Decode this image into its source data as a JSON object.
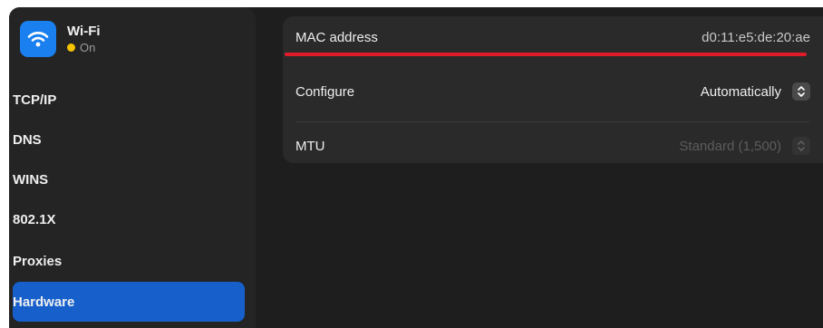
{
  "sidebar": {
    "header": {
      "title": "Wi-Fi",
      "status": "On",
      "status_color": "#f5c400",
      "icon": "wifi-icon"
    },
    "items": [
      {
        "label": "TCP/IP",
        "active": false
      },
      {
        "label": "DNS",
        "active": false
      },
      {
        "label": "WINS",
        "active": false
      },
      {
        "label": "802.1X",
        "active": false
      },
      {
        "label": "Proxies",
        "active": false
      },
      {
        "label": "Hardware",
        "active": true
      }
    ]
  },
  "hardware": {
    "mac": {
      "label": "MAC address",
      "value": "d0:11:e5:de:20:ae"
    },
    "configure": {
      "label": "Configure",
      "value": "Automatically"
    },
    "mtu": {
      "label": "MTU",
      "value": "Standard (1,500)",
      "disabled": true
    }
  },
  "colors": {
    "accent": "#1760cc",
    "annotation": "#e01c2a"
  }
}
